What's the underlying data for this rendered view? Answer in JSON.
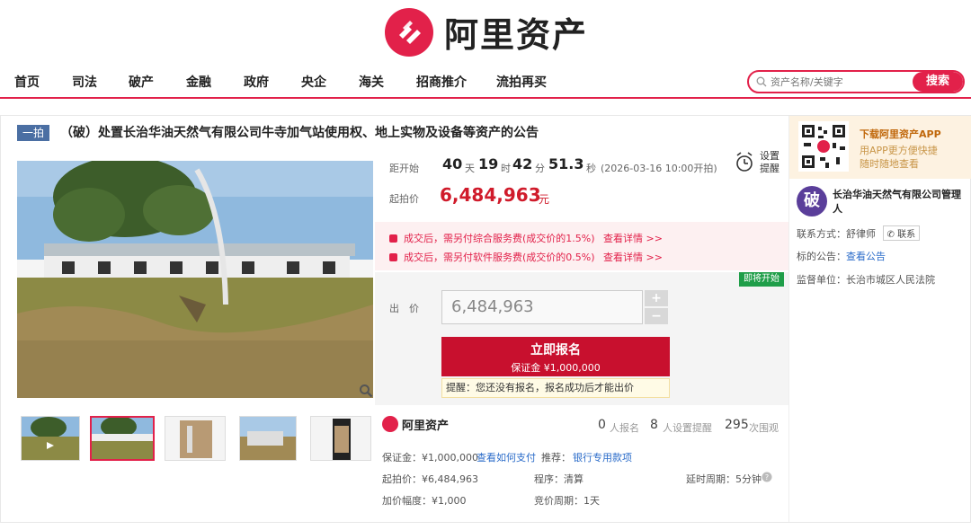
{
  "brand": {
    "name": "阿里资产",
    "accent": "#e2214a"
  },
  "nav": {
    "items": [
      "首页",
      "司法",
      "破产",
      "金融",
      "政府",
      "央企",
      "海关",
      "招商推介",
      "流拍再买"
    ],
    "search_placeholder": "资产名称/关键字",
    "search_button": "搜索"
  },
  "auction": {
    "badge": "一拍",
    "title": "（破）处置长治华油天然气有限公司牛寺加气站使用权、地上实物及设备等资产的公告",
    "countdown": {
      "label": "距开始",
      "days": "40",
      "days_unit": "天",
      "hours": "19",
      "hours_unit": "时",
      "minutes": "42",
      "minutes_unit": "分",
      "seconds": "51.3",
      "seconds_unit": "秒",
      "start_note": "(2026-03-16 10:00开拍)"
    },
    "remind": {
      "line1": "设置",
      "line2": "提醒"
    },
    "start_price_label": "起拍价",
    "start_price": "6,484,963",
    "price_unit": "元",
    "fees": [
      {
        "text": "成交后，需另付综合服务费(成交价的1.5%)",
        "link": "查看详情 >>"
      },
      {
        "text": "成交后，需另付软件服务费(成交价的0.5%)",
        "link": "查看详情 >>"
      }
    ],
    "soon_badge": "即将开始",
    "bid_label": "出　价",
    "bid_value": "6,484,963",
    "plus": "+",
    "minus": "−",
    "signup_label": "立即报名",
    "deposit_label": "保证金 ¥1,000,000",
    "tip": "提醒：您还没有报名，报名成功后才能出价",
    "stats": {
      "signups": "0",
      "signups_label": "人报名",
      "reminders": "8",
      "reminders_label": "人设置提醒",
      "views": "295",
      "views_label": "次围观"
    },
    "info": {
      "deposit": "保证金：¥1,000,000",
      "how_to_pay": "查看如何支付",
      "recommend_label": "推荐：",
      "recommend_link": "银行专用款项",
      "start_price": "起拍价：¥6,484,963",
      "procedure": "程序：清算",
      "delay": "延时周期：5分钟",
      "increment": "加价幅度：¥1,000",
      "cycle": "竞价周期：1天"
    }
  },
  "sidebar": {
    "app_title": "下载阿里资产APP",
    "app_sub1": "用APP更方便快捷",
    "app_sub2": "随时随地查看",
    "avatar_char": "破",
    "seller": "长治华油天然气有限公司管理人",
    "contact_label": "联系方式：",
    "contact_name": "舒律师",
    "contact_btn": "联系",
    "notice_label": "标的公告：",
    "notice_link": "查看公告",
    "supervisor_label": "监督单位：",
    "supervisor": "长治市城区人民法院"
  }
}
